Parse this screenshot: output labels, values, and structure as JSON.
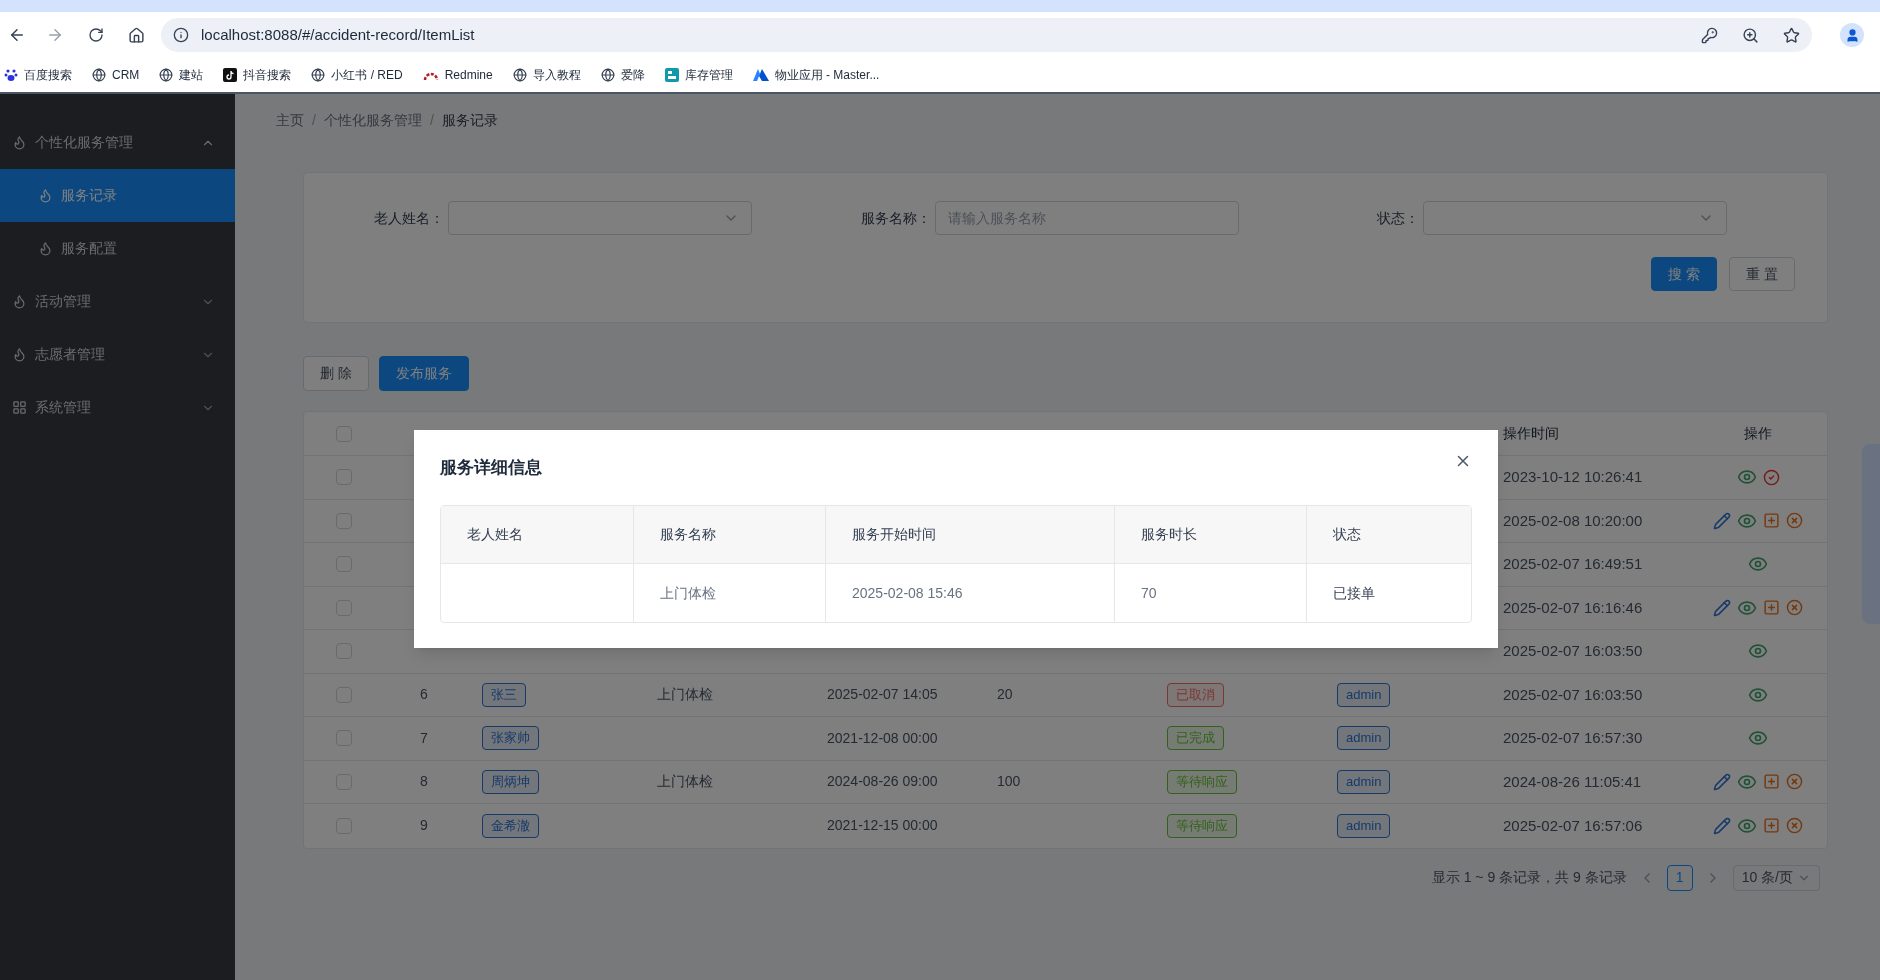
{
  "browser": {
    "address": "localhost:8088/#/accident-record/ItemList",
    "bookmarks": [
      {
        "label": "百度搜索",
        "kind": "baidu"
      },
      {
        "label": "CRM",
        "kind": "globe"
      },
      {
        "label": "建站",
        "kind": "globe"
      },
      {
        "label": "抖音搜索",
        "kind": "tiktok"
      },
      {
        "label": "小红书 / RED",
        "kind": "globe"
      },
      {
        "label": "Redmine",
        "kind": "redmine"
      },
      {
        "label": "导入教程",
        "kind": "globe"
      },
      {
        "label": "爱降",
        "kind": "globe"
      },
      {
        "label": "库存管理",
        "kind": "app"
      },
      {
        "label": "物业应用 - Master...",
        "kind": "atlas"
      }
    ]
  },
  "sidebar": {
    "items": [
      {
        "label": "个性化服务管理",
        "kind": "flame",
        "expanded": true,
        "children": [
          {
            "label": "服务记录",
            "selected": true
          },
          {
            "label": "服务配置",
            "selected": false
          }
        ]
      },
      {
        "label": "活动管理",
        "kind": "flame",
        "expanded": false
      },
      {
        "label": "志愿者管理",
        "kind": "flame",
        "expanded": false
      },
      {
        "label": "系统管理",
        "kind": "grid",
        "expanded": false
      }
    ]
  },
  "breadcrumb": [
    {
      "label": "主页",
      "separator": "/"
    },
    {
      "label": "个性化服务管理",
      "separator": "/"
    },
    {
      "label": "服务记录"
    }
  ],
  "filters": [
    {
      "label": "老人姓名：",
      "kind": "select"
    },
    {
      "label": "服务名称：",
      "kind": "input",
      "placeholder": "请输入服务名称"
    },
    {
      "label": "状态：",
      "kind": "select"
    }
  ],
  "filter_buttons": [
    {
      "label": "搜 索",
      "kind": "primary"
    },
    {
      "label": "重 置",
      "kind": "default"
    }
  ],
  "toolbar_buttons": [
    {
      "label": "删 除",
      "kind": "default"
    },
    {
      "label": "发布服务",
      "kind": "primary"
    }
  ],
  "table": {
    "header_checked": false,
    "columns": [
      null,
      null,
      null,
      null,
      null,
      null,
      null,
      "操作时间",
      "操作"
    ],
    "rows": [
      {
        "checked": false,
        "operation_time": "2023-10-12 10:26:41",
        "actions": [
          {
            "kind": "view"
          },
          {
            "kind": "approve"
          }
        ]
      },
      {
        "checked": false,
        "operation_time": "2025-02-08 10:20:00",
        "actions": [
          {
            "kind": "edit"
          },
          {
            "kind": "view"
          },
          {
            "kind": "add"
          },
          {
            "kind": "cancel"
          }
        ]
      },
      {
        "checked": false,
        "operation_time": "2025-02-07 16:49:51",
        "actions": [
          {
            "kind": "view"
          }
        ]
      },
      {
        "checked": false,
        "operation_time": "2025-02-07 16:16:46",
        "actions": [
          {
            "kind": "edit"
          },
          {
            "kind": "view"
          },
          {
            "kind": "add"
          },
          {
            "kind": "cancel"
          }
        ]
      },
      {
        "checked": false,
        "operation_time": "2025-02-07 16:03:50",
        "actions": [
          {
            "kind": "view"
          }
        ]
      },
      {
        "checked": false,
        "number": "6",
        "elder_name": "张三",
        "service_name": "上门体检",
        "start_time": "2025-02-07 14:05",
        "duration": "20",
        "status": {
          "label": "已取消",
          "kind": "danger"
        },
        "operator": "admin",
        "operation_time": "2025-02-07 16:03:50",
        "actions": [
          {
            "kind": "view"
          }
        ]
      },
      {
        "checked": false,
        "number": "7",
        "elder_name": "张家帅",
        "start_time": "2021-12-08 00:00",
        "status": {
          "label": "已完成",
          "kind": "success"
        },
        "operator": "admin",
        "operation_time": "2025-02-07 16:57:30",
        "actions": [
          {
            "kind": "view"
          }
        ]
      },
      {
        "checked": false,
        "number": "8",
        "elder_name": "周炳坤",
        "service_name": "上门体检",
        "start_time": "2024-08-26 09:00",
        "duration": "100",
        "status": {
          "label": "等待响应",
          "kind": "success"
        },
        "operator": "admin",
        "operation_time": "2024-08-26 11:05:41",
        "actions": [
          {
            "kind": "edit"
          },
          {
            "kind": "view"
          },
          {
            "kind": "add"
          },
          {
            "kind": "cancel"
          }
        ]
      },
      {
        "checked": false,
        "number": "9",
        "elder_name": "金希澈",
        "start_time": "2021-12-15 00:00",
        "status": {
          "label": "等待响应",
          "kind": "success"
        },
        "operator": "admin",
        "operation_time": "2025-02-07 16:57:06",
        "actions": [
          {
            "kind": "edit"
          },
          {
            "kind": "view"
          },
          {
            "kind": "add"
          },
          {
            "kind": "cancel"
          }
        ]
      }
    ]
  },
  "pagination": {
    "summary": "显示 1 ~ 9 条记录，共 9 条记录",
    "pages": [
      {
        "label": "1",
        "selected": true
      }
    ],
    "page_size": "10 条/页"
  },
  "modal": {
    "title": "服务详细信息",
    "columns": [
      "老人姓名",
      "服务名称",
      "服务开始时间",
      "服务时长",
      "状态"
    ],
    "rows": [
      {
        "cells": [
          null,
          "上门体检",
          "2025-02-08 15:46",
          "70",
          "已接单"
        ]
      }
    ]
  }
}
